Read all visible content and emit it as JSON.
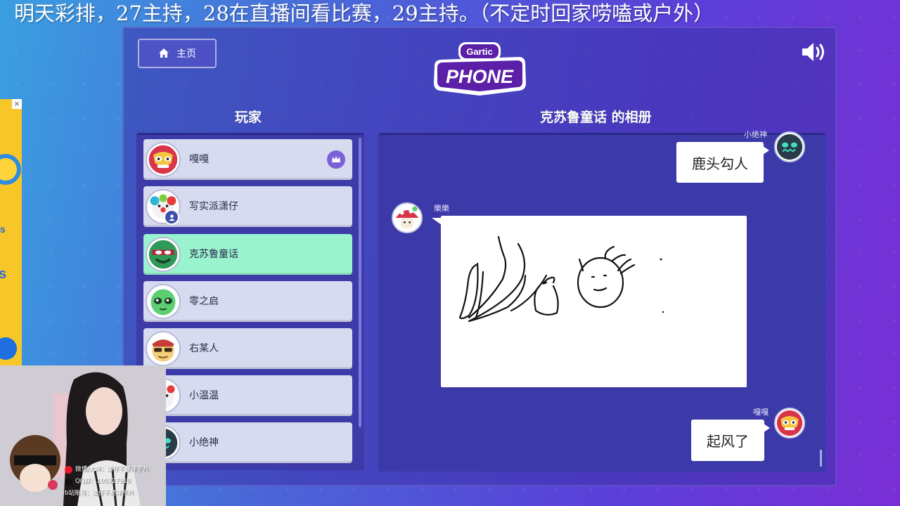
{
  "ticker": {
    "text": "明天彩排，27主持，28在直播间看比赛，29主持。（不定时回家唠嗑或户外）"
  },
  "header": {
    "home_label": "主页",
    "logo_top": "Gartic",
    "logo_bottom": "PHONE"
  },
  "players": {
    "title": "玩家",
    "items": [
      {
        "name": "嘎嘎",
        "avatar": "luchador-mask",
        "host": true,
        "active": false
      },
      {
        "name": "写实派潇仔",
        "avatar": "clown",
        "host": false,
        "active": false,
        "badge": "person"
      },
      {
        "name": "克苏鲁童话",
        "avatar": "green-ninja",
        "host": false,
        "active": true
      },
      {
        "name": "零之启",
        "avatar": "green-alien",
        "host": false,
        "active": false
      },
      {
        "name": "右某人",
        "avatar": "sunglasses-guy",
        "host": false,
        "active": false
      },
      {
        "name": "小温温",
        "avatar": "clown-small",
        "host": false,
        "active": false
      },
      {
        "name": "小绝神",
        "avatar": "dark-monster",
        "host": false,
        "active": false
      }
    ]
  },
  "album": {
    "title": "克苏鲁童话 的相册",
    "messages": [
      {
        "author": "小绝神",
        "text": "鹿头勾人",
        "side": "right"
      },
      {
        "author": "樂樂",
        "type": "drawing",
        "side": "left"
      },
      {
        "author": "嘎嘎",
        "text": "起风了",
        "side": "right"
      }
    ]
  },
  "stream_overlay": {
    "weibo": "微博/大神：潇仔不是洋芋片",
    "qq": "QQ群：100327810",
    "bili": "b站账号：潇仔不是洋芋片"
  },
  "colors": {
    "active_player": "#9af3cf",
    "player_bg": "#d7dbef",
    "crown": "#7b61d6",
    "album_bg": "#3b3aa8"
  }
}
